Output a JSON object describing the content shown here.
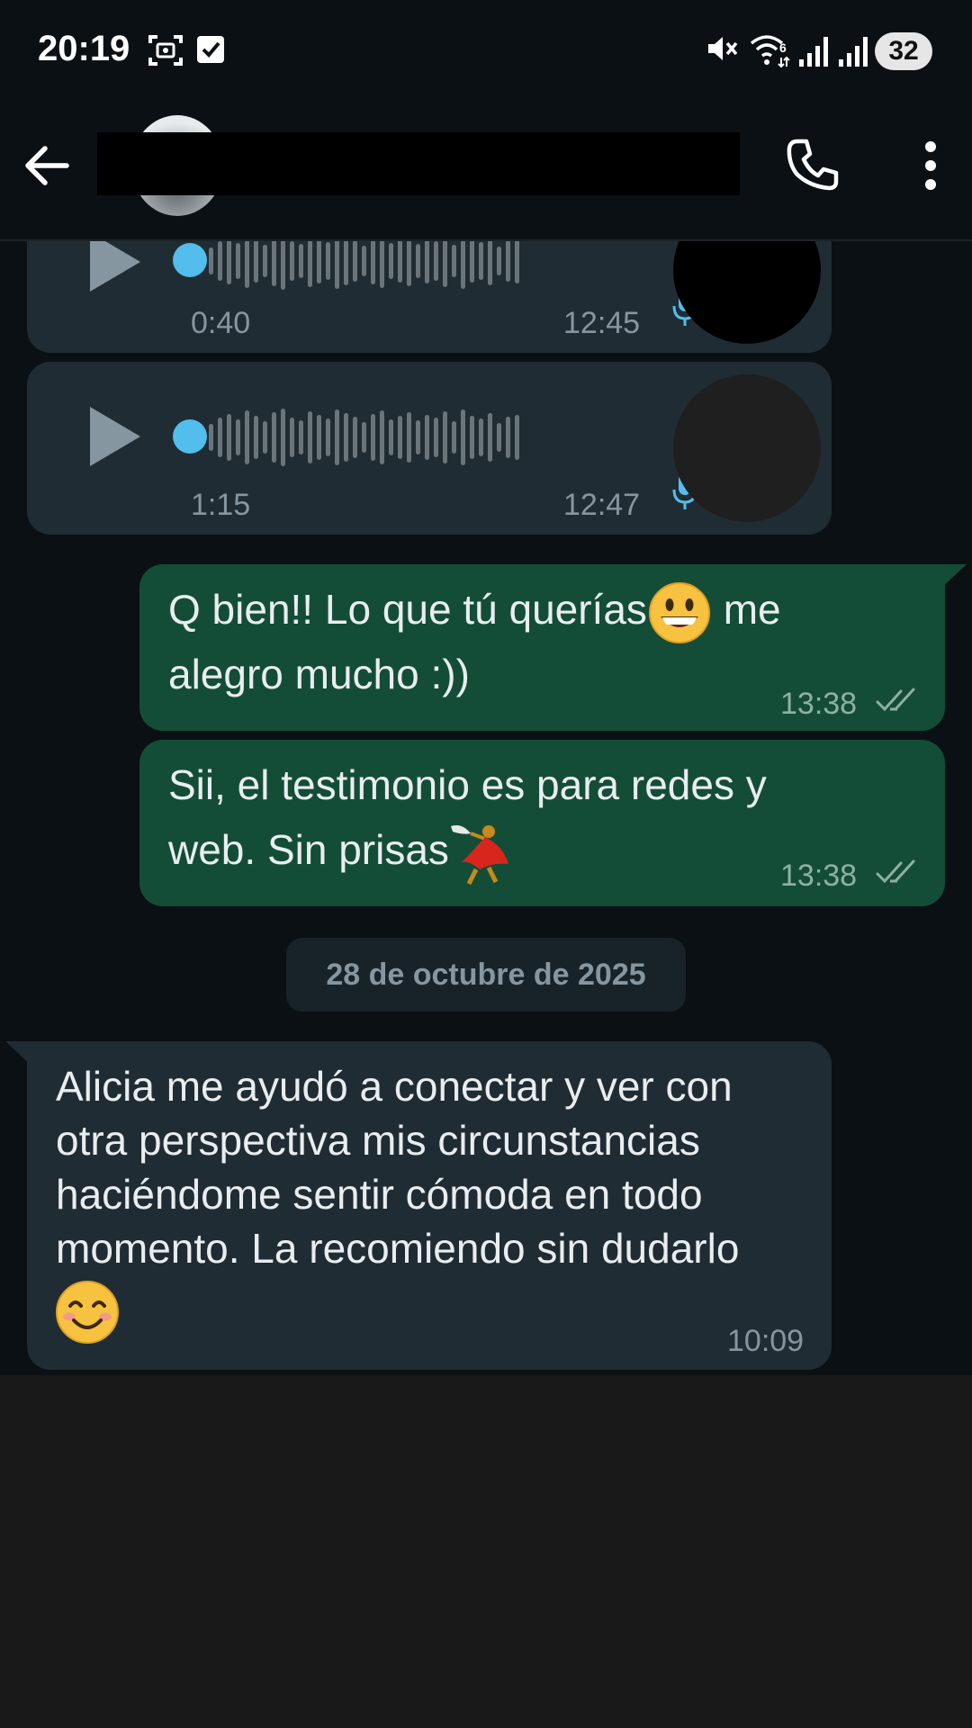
{
  "status_bar": {
    "time": "20:19",
    "battery": "32",
    "icons": [
      "screenshot-icon",
      "checkbox-icon",
      "mute-icon",
      "wifi-icon",
      "signal-icon",
      "signal-icon"
    ]
  },
  "header": {
    "back_icon": "arrow-left-icon",
    "call_icon": "phone-icon",
    "menu_icon": "more-vertical-icon"
  },
  "messages": [
    {
      "type": "voice",
      "direction": "incoming",
      "duration": "0:40",
      "time": "12:45"
    },
    {
      "type": "voice",
      "direction": "incoming",
      "duration": "1:15",
      "time": "12:47"
    },
    {
      "type": "text",
      "direction": "outgoing",
      "text_line1": "Q bien!! Lo que tú querías",
      "text_line1_end": " me",
      "text_line2": "alegro mucho :))",
      "time": "13:38",
      "status": "read"
    },
    {
      "type": "text",
      "direction": "outgoing",
      "text_line1": "Sii, el testimonio es para redes y",
      "text_line2": "web. Sin prisas",
      "time": "13:38",
      "status": "read"
    },
    {
      "type": "date",
      "label": "28 de octubre de 2025"
    },
    {
      "type": "text",
      "direction": "incoming",
      "lines": [
        "Alicia me ayudó a conectar y ver con",
        "otra perspectiva mis circunstancias",
        "haciéndome sentir cómoda en todo",
        "momento. La recomiendo sin dudarlo"
      ],
      "time": "10:09"
    }
  ],
  "colors": {
    "background": "#0b1014",
    "incoming_bubble": "#202c33",
    "outgoing_bubble": "#144d37",
    "voice_dot": "#53bdeb",
    "read_checks": "#8fb0a3"
  }
}
